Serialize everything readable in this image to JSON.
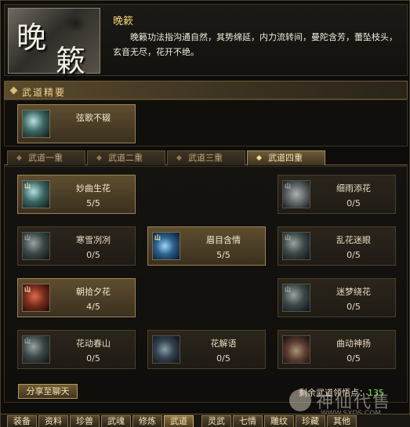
{
  "header": {
    "logo_chars": [
      "晚",
      "簌"
    ],
    "title": "晚簌",
    "description": "晚籁功法指沟通自然，其势绵延，内力流转间，曼陀含芳，蕾坠枝头，玄音无尽，花开不绝。"
  },
  "section": {
    "label": "武道精要"
  },
  "essence": {
    "name": "弦歌不辍",
    "icon": "scroll-teal-icon"
  },
  "tabs": [
    {
      "label": "武道一重",
      "active": false
    },
    {
      "label": "武道二重",
      "active": false
    },
    {
      "label": "武道三重",
      "active": false
    },
    {
      "label": "武道四重",
      "active": true
    }
  ],
  "skills": [
    {
      "name": "妙曲生花",
      "points": "5/5",
      "icon": "blade-teal-icon",
      "badge": "山"
    },
    {
      "name": "细雨添花",
      "points": "0/5",
      "icon": "splash-pale-icon",
      "badge": "山"
    },
    {
      "name": "寒雪冽冽",
      "points": "0/5",
      "icon": "wind-teal-icon",
      "badge": "山"
    },
    {
      "name": "眉目含情",
      "points": "5/5",
      "icon": "strike-blue-icon",
      "badge": "山"
    },
    {
      "name": "乱花迷眼",
      "points": "0/5",
      "icon": "wave-teal-icon",
      "badge": "山"
    },
    {
      "name": "朝拾夕花",
      "points": "4/5",
      "icon": "flower-red-icon",
      "badge": "山"
    },
    {
      "name": "迷梦绕花",
      "points": "0/5",
      "icon": "mist-teal-icon",
      "badge": "山"
    },
    {
      "name": "花动春山",
      "points": "0/5",
      "icon": "slash-teal-icon",
      "badge": "山"
    },
    {
      "name": "花解语",
      "points": "0/5",
      "icon": "burst-blue-icon",
      "badge": ""
    },
    {
      "name": "曲动神扬",
      "points": "0/5",
      "icon": "flame-red-icon",
      "badge": ""
    }
  ],
  "footer": {
    "share_label": "分享至聊天",
    "remain_label": "剩余武道领悟点：",
    "remain_value": "135",
    "watermark_text": "神仙代售",
    "watermark_url": "WWW.SXDS.COM"
  },
  "nav": [
    "装备",
    "资料",
    "珍兽",
    "武魂",
    "修炼",
    "武道",
    "灵武",
    "七情",
    "雕纹",
    "珍藏",
    "其他"
  ]
}
